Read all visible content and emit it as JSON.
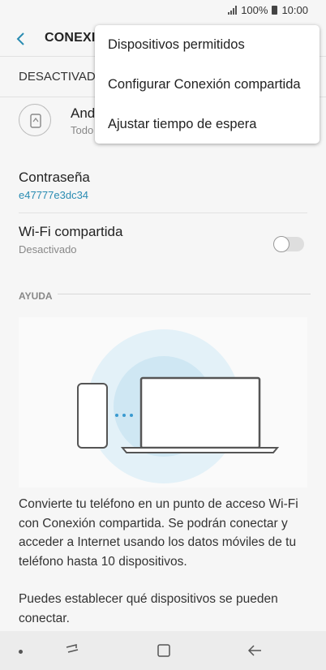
{
  "status_bar": {
    "battery": "100%",
    "time": "10:00"
  },
  "header": {
    "title": "CONEXIÓ"
  },
  "state_row": {
    "label": "DESACTIVAD"
  },
  "device": {
    "name": "And",
    "subtitle": "Todo"
  },
  "password": {
    "title": "Contraseña",
    "value": "e47777e3dc34"
  },
  "wifi_shared": {
    "title": "Wi-Fi compartida",
    "status": "Desactivado",
    "enabled": false
  },
  "help": {
    "section_label": "AYUDA",
    "paragraph_1": "Convierte tu teléfono en un punto de acceso Wi-Fi con Conexión compartida. Se podrán conectar y acceder a Internet usando los datos móviles de tu teléfono hasta 10 dispositivos.",
    "paragraph_2": "Puedes establecer qué dispositivos se pueden conectar."
  },
  "menu": {
    "items": [
      "Dispositivos permitidos",
      "Configurar Conexión compartida",
      "Ajustar tiempo de espera"
    ]
  },
  "colors": {
    "accent": "#2a8cb2",
    "illustration_circle_outer": "#e3f1f8",
    "illustration_circle_inner": "#cfe7f3"
  }
}
